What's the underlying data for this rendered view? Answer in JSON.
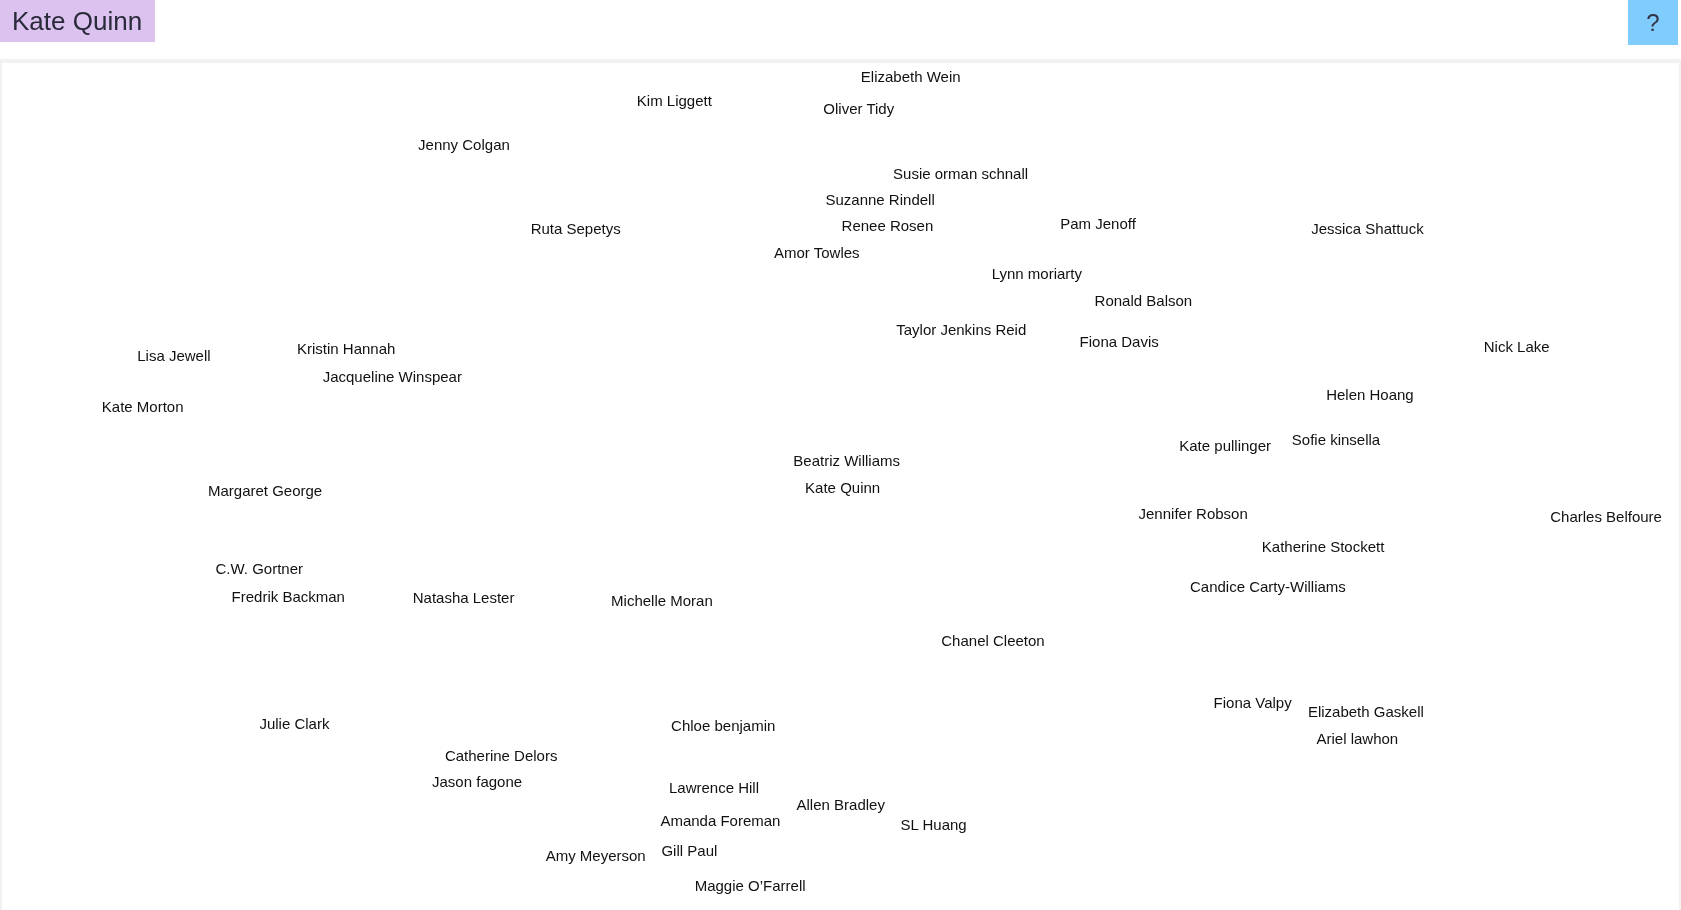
{
  "header": {
    "title": "Kate Quinn",
    "help": "?"
  },
  "map": {
    "authors": [
      "Elizabeth Wein",
      "Kim Liggett",
      "Oliver Tidy",
      "Jenny Colgan",
      "Susie orman schnall",
      "Suzanne Rindell",
      "Renee Rosen",
      "Pam Jenoff",
      "Ruta Sepetys",
      "Jessica Shattuck",
      "Amor Towles",
      "Lynn moriarty",
      "Ronald Balson",
      "Taylor Jenkins Reid",
      "Fiona Davis",
      "Nick Lake",
      "Lisa Jewell",
      "Kristin Hannah",
      "Jacqueline Winspear",
      "Helen Hoang",
      "Kate Morton",
      "Kate pullinger",
      "Sofie kinsella",
      "Beatriz Williams",
      "Kate Quinn",
      "Margaret George",
      "Jennifer Robson",
      "Charles Belfoure",
      "Katherine Stockett",
      "C.W. Gortner",
      "Fredrik Backman",
      "Natasha Lester",
      "Michelle Moran",
      "Candice Carty-Williams",
      "Chanel Cleeton",
      "Fiona Valpy",
      "Elizabeth Gaskell",
      "Julie Clark",
      "Chloe benjamin",
      "Ariel lawhon",
      "Catherine Delors",
      "Jason fagone",
      "Lawrence Hill",
      "Allen Bradley",
      "SL Huang",
      "Amanda Foreman",
      "Amy Meyerson",
      "Gill Paul",
      "Maggie O’Farrell"
    ]
  }
}
